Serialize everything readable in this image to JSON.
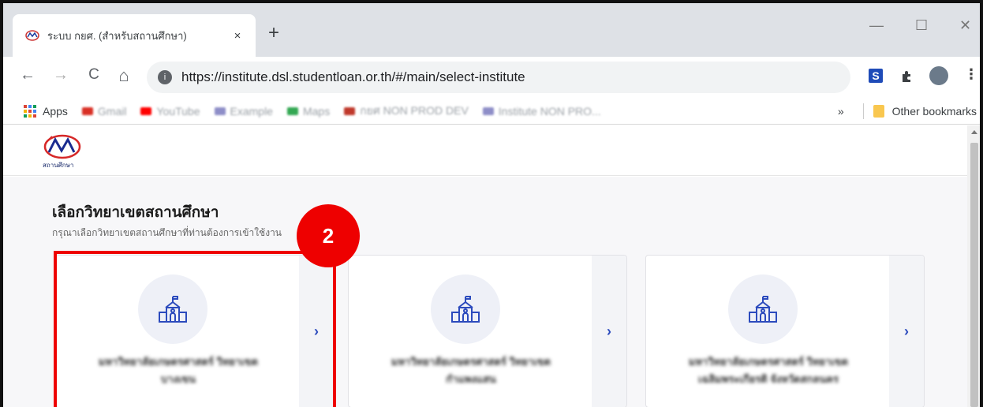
{
  "browser": {
    "tab": {
      "title": "ระบบ กยศ. (สำหรับสถานศึกษา)",
      "close": "×"
    },
    "new_tab": "+",
    "window_controls": {
      "minimize": "—",
      "maximize": "☐",
      "close": "✕"
    },
    "nav": {
      "back": "←",
      "forward": "→",
      "reload": "C",
      "home": "⌂"
    },
    "url": "https://institute.dsl.studentloan.or.th/#/main/select-institute",
    "bookmarks": {
      "apps": "Apps",
      "items": [
        "Gmail",
        "YouTube",
        "Example",
        "Maps",
        "กยศ NON PROD DEV",
        "Institute NON PRO..."
      ],
      "overflow": "»",
      "other": "Other bookmarks"
    }
  },
  "page": {
    "logo_text": "สถานศึกษา",
    "heading": "เลือกวิทยาเขตสถานศึกษา",
    "subheading": "กรุณาเลือกวิทยาเขตสถานศึกษาที่ท่านต้องการเข้าใช้งาน",
    "cards": [
      {
        "line1": "มหาวิทยาลัยเกษตรศาสตร์ วิทยาเขต",
        "line2": "บางเขน",
        "arrow": "›"
      },
      {
        "line1": "มหาวิทยาลัยเกษตรศาสตร์ วิทยาเขต",
        "line2": "กำแพงแสน",
        "arrow": "›"
      },
      {
        "line1": "มหาวิทยาลัยเกษตรศาสตร์ วิทยาเขต",
        "line2": "เฉลิมพระเกียรติ จังหวัดสกลนคร",
        "arrow": "›"
      }
    ]
  },
  "annotation": {
    "step": "2",
    "color": "#e00000"
  },
  "colors": {
    "accent": "#2c4bbd",
    "icon_circle": "#eef0f7"
  }
}
